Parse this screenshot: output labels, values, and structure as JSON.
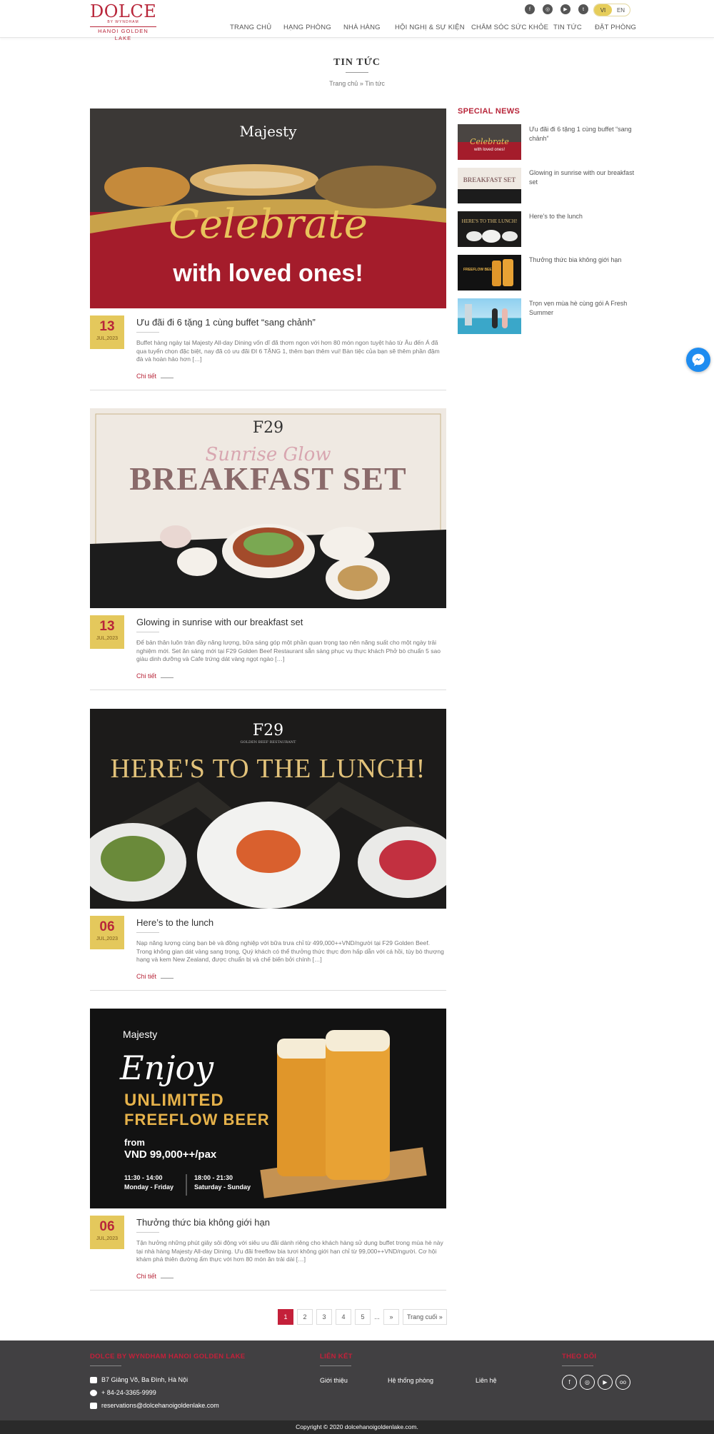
{
  "brand": {
    "logo_main": "DOLCE",
    "logo_sub": "BY WYNDHAM",
    "logo_place": "HANOI GOLDEN LAKE"
  },
  "header": {
    "lang_vi": "VI",
    "lang_en": "EN",
    "nav": [
      "TRANG CHỦ",
      "HẠNG PHÒNG",
      "NHÀ HÀNG",
      "HỘI NGHỊ & SỰ KIỆN",
      "CHĂM SÓC SỨC KHỎE",
      "TIN TỨC",
      "ĐẶT PHÒNG"
    ],
    "social_icons": [
      "facebook-icon",
      "instagram-icon",
      "youtube-icon",
      "twitter-icon"
    ]
  },
  "page": {
    "title": "TIN TỨC",
    "breadcrumb": "Trang chủ » Tin tức"
  },
  "articles": [
    {
      "day": "13",
      "month": "JUL,2023",
      "title": "Ưu đãi đi 6 tặng 1 cùng buffet “sang chảnh”",
      "desc": "Buffet hàng ngày tại Majesty All-day Dining vốn dĩ đã thơm ngon với hơn 80 món ngon tuyệt hảo từ Âu đến Á đã qua tuyển chọn đặc biệt, nay đã có ưu đãi ĐI 6 TẶNG 1, thêm bạn thêm vui! Bàn tiệc của bạn sẽ thêm phần đậm đà và hoàn hảo hơn […]",
      "more": "Chi tiết",
      "image_text_1": "Majesty",
      "image_text_2": "Celebrate",
      "image_text_3": "with loved ones!"
    },
    {
      "day": "13",
      "month": "JUL,2023",
      "title": "Glowing in sunrise with our breakfast set",
      "desc": "Để bản thân luôn tràn đầy năng lượng, bữa sáng góp một phần quan trọng tạo nên năng suất cho một ngày trải nghiệm mới. Set ăn sáng mới tại F29 Golden Beef Restaurant sẵn sàng phục vụ thực khách Phở bò chuẩn 5 sao giàu dinh dưỡng và Cafe trứng dát vàng ngọt ngào […]",
      "more": "Chi tiết",
      "image_text_1": "F29",
      "image_text_2": "Sunrise Glow",
      "image_text_3": "BREAKFAST SET"
    },
    {
      "day": "06",
      "month": "JUL,2023",
      "title": "Here’s to the lunch",
      "desc": "Nạp năng lượng cùng bạn bè và đồng nghiệp với bữa trưa chỉ từ 499,000++VND/người tại F29 Golden Beef. Trong không gian dát vàng sang trọng, Quý khách có thể thưởng thức thực đơn hấp dẫn với cá hồi, tùy bò thượng hạng và kem New Zealand, được chuẩn bị và chế biến bởi chính […]",
      "more": "Chi tiết",
      "image_text_1": "F29",
      "image_text_2": "HERE'S TO THE LUNCH!",
      "image_text_3": "GOLDEN BEEF RESTAURANT"
    },
    {
      "day": "06",
      "month": "JUL,2023",
      "title": "Thưởng thức bia không giới hạn",
      "desc": "Tận hưởng những phút giây sôi động với siêu ưu đãi dành riêng cho khách hàng sử dụng buffet trong mùa hè này tại nhà hàng Majesty All-day Dining. Ưu đãi freeflow bia tươi không giới hạn chỉ từ 99,000++VND/người. Cơ hội khám phá thiên đường ẩm thực với hơn 80 món ăn trải dài […]",
      "more": "Chi tiết",
      "image_text_1": "Majesty",
      "image_text_2": "Enjoy",
      "image_text_3": "UNLIMITED",
      "image_text_4": "FREEFLOW BEER",
      "image_text_5": "from",
      "image_text_6": "VND 99,000++/pax",
      "image_text_7": "11:30 - 14:00",
      "image_text_8": "Monday - Friday",
      "image_text_9": "18:00 - 21:30",
      "image_text_10": "Saturday - Sunday"
    }
  ],
  "sidebar": {
    "title": "SPECIAL NEWS",
    "items": [
      {
        "label": "Ưu đãi đi 6 tặng 1 cùng buffet “sang chảnh”"
      },
      {
        "label": "Glowing in sunrise with our breakfast set"
      },
      {
        "label": "Here’s to the lunch"
      },
      {
        "label": "Thưởng thức bia không giới hạn"
      },
      {
        "label": "Trọn vẹn mùa hè cùng gói A Fresh Summer"
      }
    ]
  },
  "pagination": {
    "pages": [
      "1",
      "2",
      "3",
      "4",
      "5"
    ],
    "dots": "...",
    "next": "»",
    "last": "Trang cuối »",
    "current": "1"
  },
  "footer": {
    "col1_title": "DOLCE BY WYNDHAM HANOI GOLDEN LAKE",
    "address": "B7 Giảng Võ, Ba Đình, Hà Nội",
    "phone": "+ 84-24-3365-9999",
    "email": "reservations@dolcehanoigoldenlake.com",
    "col2_title": "LIÊN KẾT",
    "link_1": "Giới thiệu",
    "link_2": "Hệ thống phòng",
    "link_3": "Liên hệ",
    "col3_title": "THEO DÕI",
    "copyright": "Copyright © 2020 dolcehanoigoldenlake.com."
  },
  "colors": {
    "brand_red": "#b8263a",
    "gold": "#e4c85c",
    "footer_bg": "#414042"
  }
}
